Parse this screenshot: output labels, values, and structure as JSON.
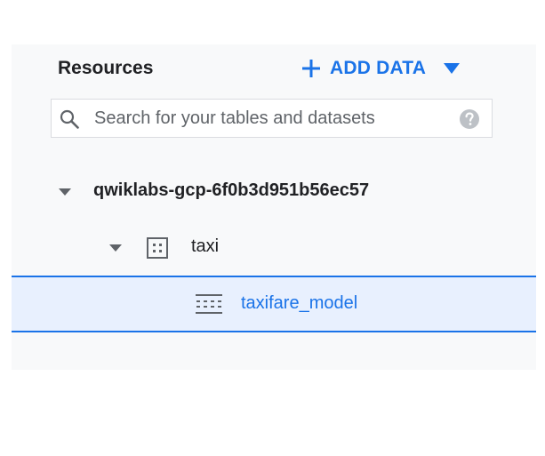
{
  "resources_panel": {
    "title": "Resources",
    "add_data_label": "ADD DATA",
    "search": {
      "placeholder": "Search for your tables and datasets",
      "value": ""
    },
    "tree": {
      "project": {
        "label": "qwiklabs-gcp-6f0b3d951b56ec57",
        "expanded": true
      },
      "dataset": {
        "label": "taxi",
        "expanded": true,
        "icon": "dataset-icon"
      },
      "model": {
        "label": "taxifare_model",
        "icon": "model-icon",
        "selected": true
      }
    }
  },
  "colors": {
    "accent": "#1a73e8",
    "panel_background": "#f8f9fa",
    "selected_background": "#e8f0fe",
    "text": "#202124",
    "muted": "#5f6368"
  }
}
